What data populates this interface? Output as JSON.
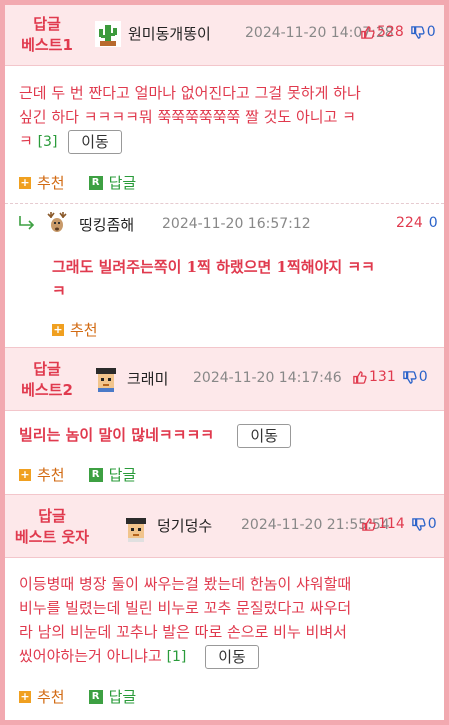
{
  "comments": [
    {
      "badge_line1": "답글",
      "badge_line2": "베스트1",
      "nickname": "원미동개똥이",
      "date": "2024-11-20 14:07:28",
      "up": "528",
      "down": "0",
      "body_line1": "근데 두 번 짠다고 얼마나 없어진다고 그걸 못하게 하나",
      "body_line2": "싶긴 하다 ㅋㅋㅋㅋ뭐 쭉쭉쭉쭉쭉쭉 짤 것도 아니고 ㅋ",
      "body_line3": "ㅋ",
      "reply_count": "[3]",
      "move_label": "이동",
      "recommend_label": "추천",
      "reply_label": "답글"
    },
    {
      "nickname": "띵킹좀해",
      "date": "2024-11-20 16:57:12",
      "up": "224",
      "down": "0",
      "body_line1": "그래도 빌려주는쪽이 1찍 하랬으면 1찍해야지 ㅋㅋ",
      "body_line2": "ㅋ",
      "recommend_label": "추천"
    },
    {
      "badge_line1": "답글",
      "badge_line2": "베스트2",
      "nickname": "크래미",
      "date": "2024-11-20 14:17:46",
      "up": "131",
      "down": "0",
      "body_line1": "빌리는 놈이 말이 많네ㅋㅋㅋㅋ",
      "move_label": "이동",
      "recommend_label": "추천",
      "reply_label": "답글"
    },
    {
      "badge_line1": "답글",
      "badge_line2": "베스트 웃자",
      "nickname": "덩기덩수",
      "date": "2024-11-20 21:55:54",
      "up": "114",
      "down": "0",
      "body_line1": "이등병때 병장 둘이 싸우는걸 봤는데 한놈이 샤워할때",
      "body_line2": "비누를 빌렸는데 빌린 비누로 꼬추 문질렀다고 싸우더",
      "body_line3": "라 남의 비눈데 꼬추나 발은 따로 손으로 비누 비벼서",
      "body_line4": "씼어야하는거 아니냐고",
      "reply_count": "[1]",
      "move_label": "이동",
      "recommend_label": "추천",
      "reply_label": "답글"
    }
  ],
  "icons": {
    "thumb_up": "thumbs-up-icon",
    "thumb_down": "thumbs-down-icon",
    "recommend": "plus-icon",
    "reply": "reply-r-icon",
    "nested": "nested-reply-arrow-icon"
  },
  "colors": {
    "accent": "#e03a4e",
    "border": "#f2a9b0",
    "header_bg": "#fde8ea",
    "down_blue": "#2a62c9",
    "reply_green": "#2a9b3a",
    "recommend_orange": "#d26a12"
  }
}
